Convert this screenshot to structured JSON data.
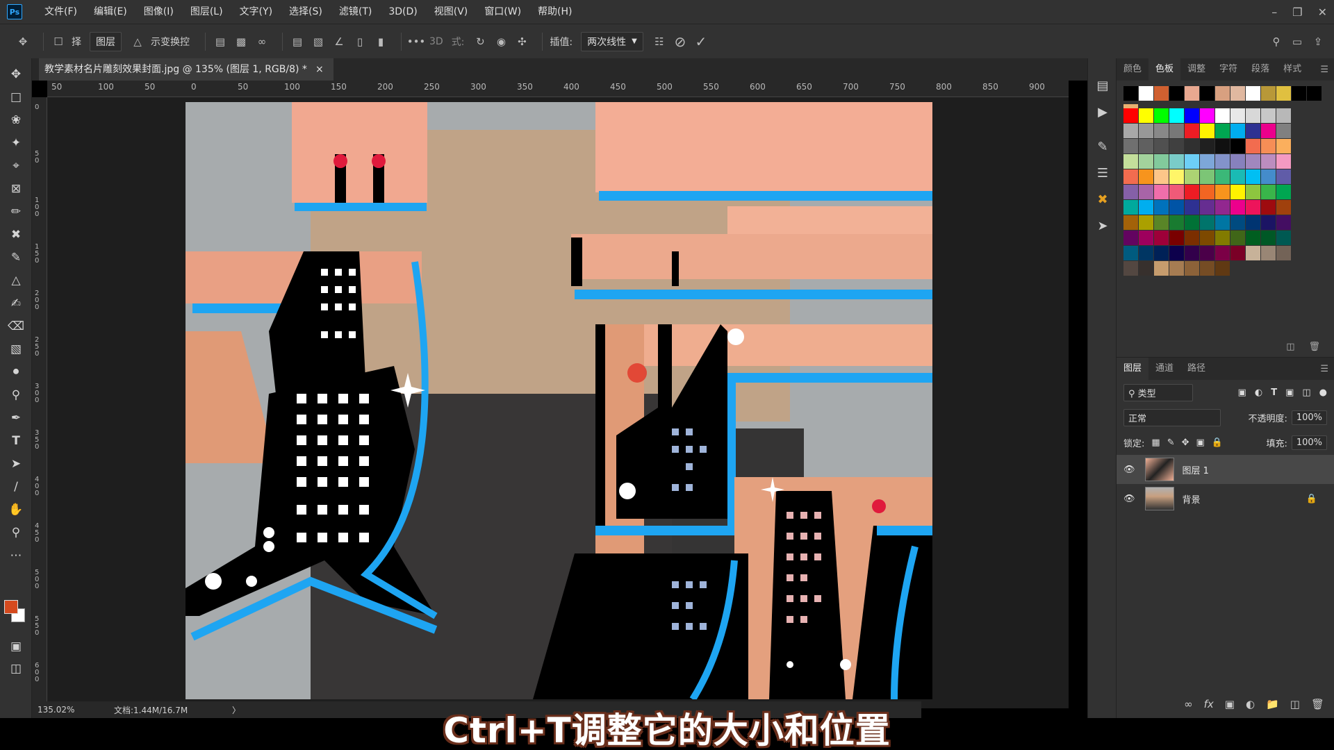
{
  "app": {
    "logo": "Ps"
  },
  "menu": [
    "文件(F)",
    "编辑(E)",
    "图像(I)",
    "图层(L)",
    "文字(Y)",
    "选择(S)",
    "滤镜(T)",
    "3D(D)",
    "视图(V)",
    "窗口(W)",
    "帮助(H)"
  ],
  "options": {
    "auto_select_label": "择",
    "target": "图层",
    "transform_controls": "示变换控",
    "mode_3d": "3D",
    "mode_suffix": "式:",
    "interp_label": "插值:",
    "interp_value": "两次线性"
  },
  "document": {
    "tab_title": "教学素材名片雕刻效果封面.jpg @ 135% (图层 1, RGB/8) *",
    "close": "×"
  },
  "ruler": {
    "top_ticks": [
      "50",
      "100",
      "50",
      "0",
      "50",
      "100",
      "150",
      "200",
      "250",
      "300",
      "350",
      "400",
      "450",
      "500",
      "550",
      "600",
      "650",
      "700",
      "750",
      "800",
      "850",
      "900"
    ],
    "left_ticks": [
      "0",
      "5 0",
      "1 0 0",
      "1 5 0",
      "2 0 0",
      "2 5 0",
      "3 0 0",
      "3 5 0",
      "4 0 0",
      "4 5 0",
      "5 0 0",
      "5 5 0",
      "6 0 0"
    ]
  },
  "status": {
    "zoom": "135.02%",
    "doc_info": "文档:1.44M/16.7M",
    "arrow": "〉"
  },
  "panels": {
    "top_tabs": [
      "颜色",
      "色板",
      "调整",
      "字符",
      "段落",
      "样式"
    ],
    "active_top_tab": "色板",
    "layer_tabs": [
      "图层",
      "通道",
      "路径"
    ],
    "filter_kind": "类型",
    "blend_mode": "正常",
    "opacity_label": "不透明度:",
    "opacity_value": "100%",
    "lock_label": "锁定:",
    "fill_label": "填充:",
    "fill_value": "100%",
    "layers": [
      {
        "name": "图层 1",
        "selected": true
      },
      {
        "name": "背景",
        "selected": false
      }
    ]
  },
  "swatch_rows": [
    [
      "#000000",
      "#ffffff",
      "#d06030",
      "#000000",
      "#e8a890",
      "#000000",
      "#d8a080",
      "#e0b8a0",
      "#ffffff",
      "#b89838",
      "#e0c040",
      "#000000",
      "#000000",
      "#e8b070"
    ],
    [
      "#ff0000",
      "#ffff00",
      "#00ff00",
      "#00ffff",
      "#0000ff",
      "#ff00ff",
      "#ffffff",
      "#e8e8e8",
      "#d8d8d8",
      "#c8c8c8",
      "#b8b8b8"
    ],
    [
      "#a8a8a8",
      "#989898",
      "#888888",
      "#787878",
      "#ee1c24",
      "#fff200",
      "#00a651",
      "#00aeef",
      "#2e3192",
      "#ec008c",
      "#808080"
    ],
    [
      "#707070",
      "#606060",
      "#505050",
      "#404040",
      "#303030",
      "#202020",
      "#101010",
      "#000000",
      "#f26c4f",
      "#f68e56",
      "#fbaf5d"
    ],
    [
      "#c4df9b",
      "#a3d39c",
      "#82ca9c",
      "#7accc8",
      "#6dcff6",
      "#7da7d9",
      "#8393ca",
      "#8781bd",
      "#a187be",
      "#bc8dbf",
      "#f49ac2"
    ],
    [
      "#f26c4f",
      "#f7941d",
      "#fdc689",
      "#fff568",
      "#acd373",
      "#7cc576",
      "#3bb878",
      "#1abbb4",
      "#00bff3",
      "#448ccb",
      "#605ca8"
    ],
    [
      "#8560a8",
      "#a864a8",
      "#f06eaa",
      "#f05a78",
      "#ed1c24",
      "#f26522",
      "#f7941d",
      "#fff200",
      "#8dc63f",
      "#39b54a",
      "#00a651"
    ],
    [
      "#00a99d",
      "#00aeef",
      "#0072bc",
      "#0054a6",
      "#2e3192",
      "#662d91",
      "#92278f",
      "#ec008c",
      "#ed145b",
      "#9e0b0f",
      "#a0410d"
    ],
    [
      "#a36209",
      "#aba000",
      "#598527",
      "#197b30",
      "#007236",
      "#00746b",
      "#0076a3",
      "#004b80",
      "#003471",
      "#1b1464",
      "#440e62"
    ],
    [
      "#630460",
      "#9e005d",
      "#9e0039",
      "#790000",
      "#7b2e00",
      "#7d4900",
      "#827b00",
      "#406618",
      "#005e20",
      "#005826",
      "#005952"
    ],
    [
      "#005b7f",
      "#003663",
      "#002157",
      "#0d004c",
      "#32004b",
      "#4b0049",
      "#7b0046",
      "#7a0026",
      "#c7b299",
      "#998675",
      "#736357"
    ],
    [
      "#534741",
      "#37302d",
      "#c69c6d",
      "#a67c52",
      "#8c6239",
      "#754c24",
      "#603913"
    ]
  ],
  "subtitle": "Ctrl+T调整它的大小和位置"
}
